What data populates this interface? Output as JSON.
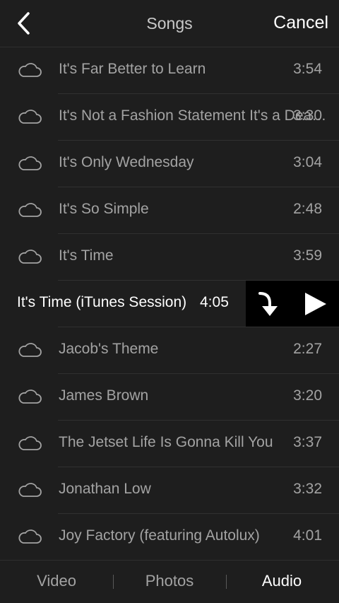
{
  "header": {
    "back_icon": "chevron-left-icon",
    "title": "Songs",
    "cancel_label": "Cancel"
  },
  "songs": [
    {
      "title": "It's Far Better to Learn",
      "duration": "3:54"
    },
    {
      "title": "It's Not a Fashion Statement It's a Deathwish",
      "duration": "3:30"
    },
    {
      "title": "It's Only Wednesday",
      "duration": "3:04"
    },
    {
      "title": "It's So Simple",
      "duration": "2:48"
    },
    {
      "title": "It's Time",
      "duration": "3:59"
    },
    {
      "title": "It's Time (iTunes Session)",
      "duration": "4:05",
      "selected": true
    },
    {
      "title": "Jacob's Theme",
      "duration": "2:27"
    },
    {
      "title": "James Brown",
      "duration": "3:20"
    },
    {
      "title": "The Jetset Life Is Gonna Kill You",
      "duration": "3:37"
    },
    {
      "title": "Jonathan Low",
      "duration": "3:32"
    },
    {
      "title": "Joy Factory (featuring Autolux)",
      "duration": "4:01"
    }
  ],
  "row_icons": {
    "cloud": "cloud-icon",
    "download": "download-arrow-icon",
    "play": "play-icon"
  },
  "tabs": [
    {
      "label": "Video"
    },
    {
      "label": "Photos"
    },
    {
      "label": "Audio",
      "active": true
    }
  ],
  "colors": {
    "background": "#1e1e1e",
    "text_dim": "#a3a3a3",
    "text_active": "#ffffff",
    "action_bg": "#000000"
  }
}
